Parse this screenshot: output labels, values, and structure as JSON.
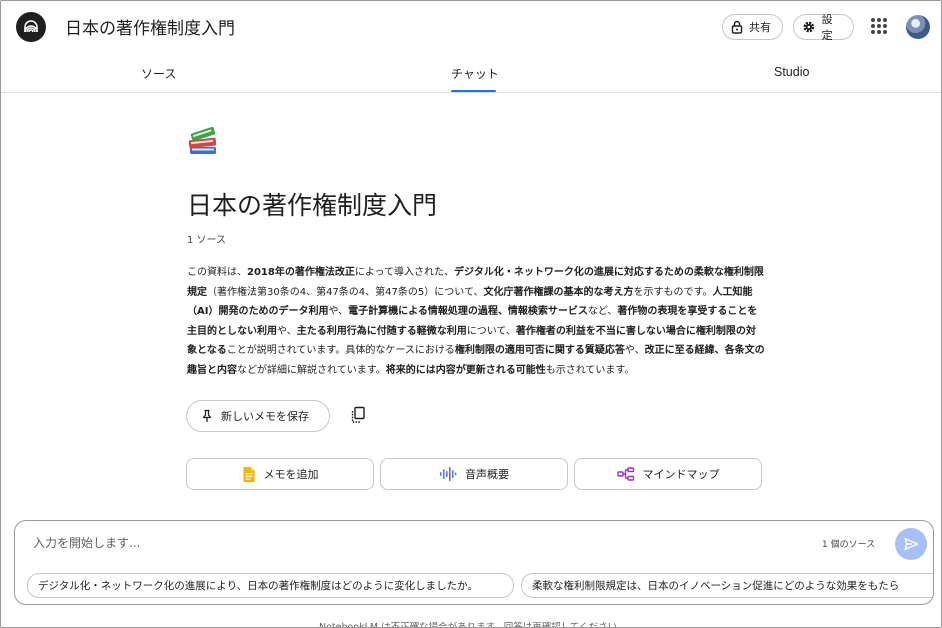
{
  "header": {
    "title": "日本の著作権制度入門",
    "share_label": "共有",
    "settings_label": "設定",
    "logo_icon": "notebook-logo-icon",
    "accent_color": "#1a73e8"
  },
  "tabs": [
    {
      "label": "ソース",
      "active": false
    },
    {
      "label": "チャット",
      "active": true
    },
    {
      "label": "Studio",
      "active": false
    }
  ],
  "notebook": {
    "emoji_icon": "books-icon",
    "title": "日本の著作権制度入門",
    "source_count": "1 ソース",
    "summary": [
      {
        "text": "この資料は、",
        "bold": false
      },
      {
        "text": "2018年の著作権法改正",
        "bold": true
      },
      {
        "text": "によって導入された、",
        "bold": false
      },
      {
        "text": "デジタル化・ネットワーク化の進展に対応するための柔軟な権利制限規定",
        "bold": true
      },
      {
        "text": "（著作権法第30条の4、第47条の4、第47条の5）について、",
        "bold": false
      },
      {
        "text": "文化庁著作権課の基本的な考え方",
        "bold": true
      },
      {
        "text": "を示すものです。",
        "bold": false
      },
      {
        "text": "人工知能（AI）開発のためのデータ利用",
        "bold": true
      },
      {
        "text": "や、",
        "bold": false
      },
      {
        "text": "電子計算機による情報処理の過程、情報検索サービス",
        "bold": true
      },
      {
        "text": "など、",
        "bold": false
      },
      {
        "text": "著作物の表現を享受することを主目的としない利用",
        "bold": true
      },
      {
        "text": "や、",
        "bold": false
      },
      {
        "text": "主たる利用行為に付随する軽微な利用",
        "bold": true
      },
      {
        "text": "について、",
        "bold": false
      },
      {
        "text": "著作権者の利益を不当に害しない場合に権利制限の対象となる",
        "bold": true
      },
      {
        "text": "ことが説明されています。具体的なケースにおける",
        "bold": false
      },
      {
        "text": "権利制限の適用可否に関する質疑応答",
        "bold": true
      },
      {
        "text": "や、",
        "bold": false
      },
      {
        "text": "改正に至る経緯、各条文の趣旨と内容",
        "bold": true
      },
      {
        "text": "などが詳細に解説されています。",
        "bold": false
      },
      {
        "text": "将来的には内容が更新される可能性",
        "bold": true
      },
      {
        "text": "も示されています。",
        "bold": false
      }
    ],
    "save_note_label": "新しいメモを保存",
    "actions": [
      {
        "label": "メモを追加",
        "icon": "note-icon"
      },
      {
        "label": "音声概要",
        "icon": "audio-wave-icon"
      },
      {
        "label": "マインドマップ",
        "icon": "mind-map-icon"
      }
    ]
  },
  "composer": {
    "placeholder": "入力を開始します...",
    "source_chip": "1 個のソース",
    "suggestions": [
      "デジタル化・ネットワーク化の進展により、日本の著作権制度はどのように変化しましたか。",
      "柔軟な権利制限規定は、日本のイノベーション促進にどのような効果をもたら"
    ]
  },
  "footer": {
    "disclaimer": "NotebookLM は不正確な場合があります。回答は再確認してください。"
  }
}
